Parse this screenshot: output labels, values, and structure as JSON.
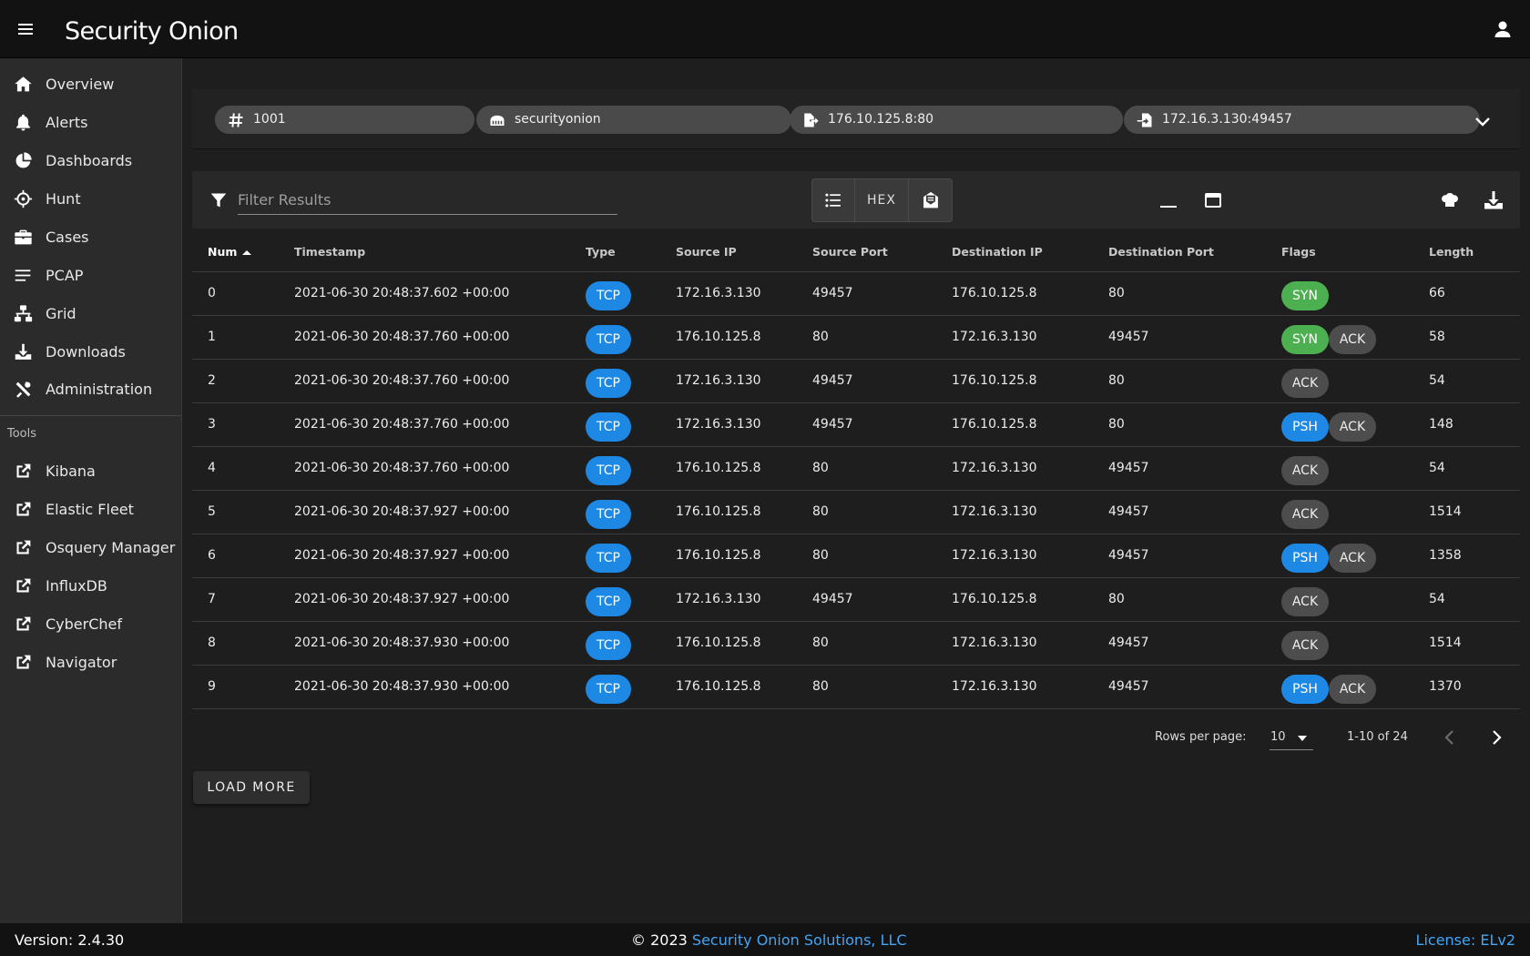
{
  "app": {
    "brand": "Security Onion"
  },
  "sidebar": {
    "items": [
      {
        "label": "Overview",
        "icon": "home-icon"
      },
      {
        "label": "Alerts",
        "icon": "bell-icon"
      },
      {
        "label": "Dashboards",
        "icon": "pie-chart-icon"
      },
      {
        "label": "Hunt",
        "icon": "crosshairs-icon"
      },
      {
        "label": "Cases",
        "icon": "briefcase-icon"
      },
      {
        "label": "PCAP",
        "icon": "list-icon"
      },
      {
        "label": "Grid",
        "icon": "network-icon"
      },
      {
        "label": "Downloads",
        "icon": "download-icon"
      },
      {
        "label": "Administration",
        "icon": "tools-icon"
      }
    ],
    "tools_header": "Tools",
    "tools": [
      {
        "label": "Kibana",
        "icon": "external-link-icon"
      },
      {
        "label": "Elastic Fleet",
        "icon": "external-link-icon"
      },
      {
        "label": "Osquery Manager",
        "icon": "external-link-icon"
      },
      {
        "label": "InfluxDB",
        "icon": "external-link-icon"
      },
      {
        "label": "CyberChef",
        "icon": "external-link-icon"
      },
      {
        "label": "Navigator",
        "icon": "external-link-icon"
      }
    ]
  },
  "header": {
    "chips": [
      {
        "label": "1001",
        "icon": "hash-icon"
      },
      {
        "label": "securityonion",
        "icon": "server-icon"
      },
      {
        "label": "176.10.125.8:80",
        "icon": "file-export-icon"
      },
      {
        "label": "172.16.3.130:49457",
        "icon": "file-import-icon"
      }
    ]
  },
  "toolbar": {
    "filter_placeholder": "Filter Results",
    "hex_label": "HEX"
  },
  "table": {
    "columns": [
      "Num",
      "Timestamp",
      "Type",
      "Source IP",
      "Source Port",
      "Destination IP",
      "Destination Port",
      "Flags",
      "Length"
    ],
    "rows": [
      {
        "num": "0",
        "ts": "2021-06-30 20:48:37.602 +00:00",
        "type": "TCP",
        "src": "172.16.3.130",
        "sport": "49457",
        "dst": "176.10.125.8",
        "dport": "80",
        "flags": [
          "SYN"
        ],
        "len": "66"
      },
      {
        "num": "1",
        "ts": "2021-06-30 20:48:37.760 +00:00",
        "type": "TCP",
        "src": "176.10.125.8",
        "sport": "80",
        "dst": "172.16.3.130",
        "dport": "49457",
        "flags": [
          "SYN",
          "ACK"
        ],
        "len": "58"
      },
      {
        "num": "2",
        "ts": "2021-06-30 20:48:37.760 +00:00",
        "type": "TCP",
        "src": "172.16.3.130",
        "sport": "49457",
        "dst": "176.10.125.8",
        "dport": "80",
        "flags": [
          "ACK"
        ],
        "len": "54"
      },
      {
        "num": "3",
        "ts": "2021-06-30 20:48:37.760 +00:00",
        "type": "TCP",
        "src": "172.16.3.130",
        "sport": "49457",
        "dst": "176.10.125.8",
        "dport": "80",
        "flags": [
          "PSH",
          "ACK"
        ],
        "len": "148"
      },
      {
        "num": "4",
        "ts": "2021-06-30 20:48:37.760 +00:00",
        "type": "TCP",
        "src": "176.10.125.8",
        "sport": "80",
        "dst": "172.16.3.130",
        "dport": "49457",
        "flags": [
          "ACK"
        ],
        "len": "54"
      },
      {
        "num": "5",
        "ts": "2021-06-30 20:48:37.927 +00:00",
        "type": "TCP",
        "src": "176.10.125.8",
        "sport": "80",
        "dst": "172.16.3.130",
        "dport": "49457",
        "flags": [
          "ACK"
        ],
        "len": "1514"
      },
      {
        "num": "6",
        "ts": "2021-06-30 20:48:37.927 +00:00",
        "type": "TCP",
        "src": "176.10.125.8",
        "sport": "80",
        "dst": "172.16.3.130",
        "dport": "49457",
        "flags": [
          "PSH",
          "ACK"
        ],
        "len": "1358"
      },
      {
        "num": "7",
        "ts": "2021-06-30 20:48:37.927 +00:00",
        "type": "TCP",
        "src": "172.16.3.130",
        "sport": "49457",
        "dst": "176.10.125.8",
        "dport": "80",
        "flags": [
          "ACK"
        ],
        "len": "54"
      },
      {
        "num": "8",
        "ts": "2021-06-30 20:48:37.930 +00:00",
        "type": "TCP",
        "src": "176.10.125.8",
        "sport": "80",
        "dst": "172.16.3.130",
        "dport": "49457",
        "flags": [
          "ACK"
        ],
        "len": "1514"
      },
      {
        "num": "9",
        "ts": "2021-06-30 20:48:37.930 +00:00",
        "type": "TCP",
        "src": "176.10.125.8",
        "sport": "80",
        "dst": "172.16.3.130",
        "dport": "49457",
        "flags": [
          "PSH",
          "ACK"
        ],
        "len": "1370"
      }
    ]
  },
  "pagination": {
    "rows_per_page_label": "Rows per page:",
    "rows_per_page": "10",
    "range": "1-10 of 24"
  },
  "load_more_label": "LOAD MORE",
  "footer": {
    "version": "Version: 2.4.30",
    "copyright_prefix": "© 2023",
    "copyright_link": "Security Onion Solutions, LLC",
    "license": "License: ELv2"
  },
  "colors": {
    "accent": "#1e88e5",
    "syn": "#4caf50",
    "ack": "#4d4d4d",
    "link": "#42a5f5"
  }
}
